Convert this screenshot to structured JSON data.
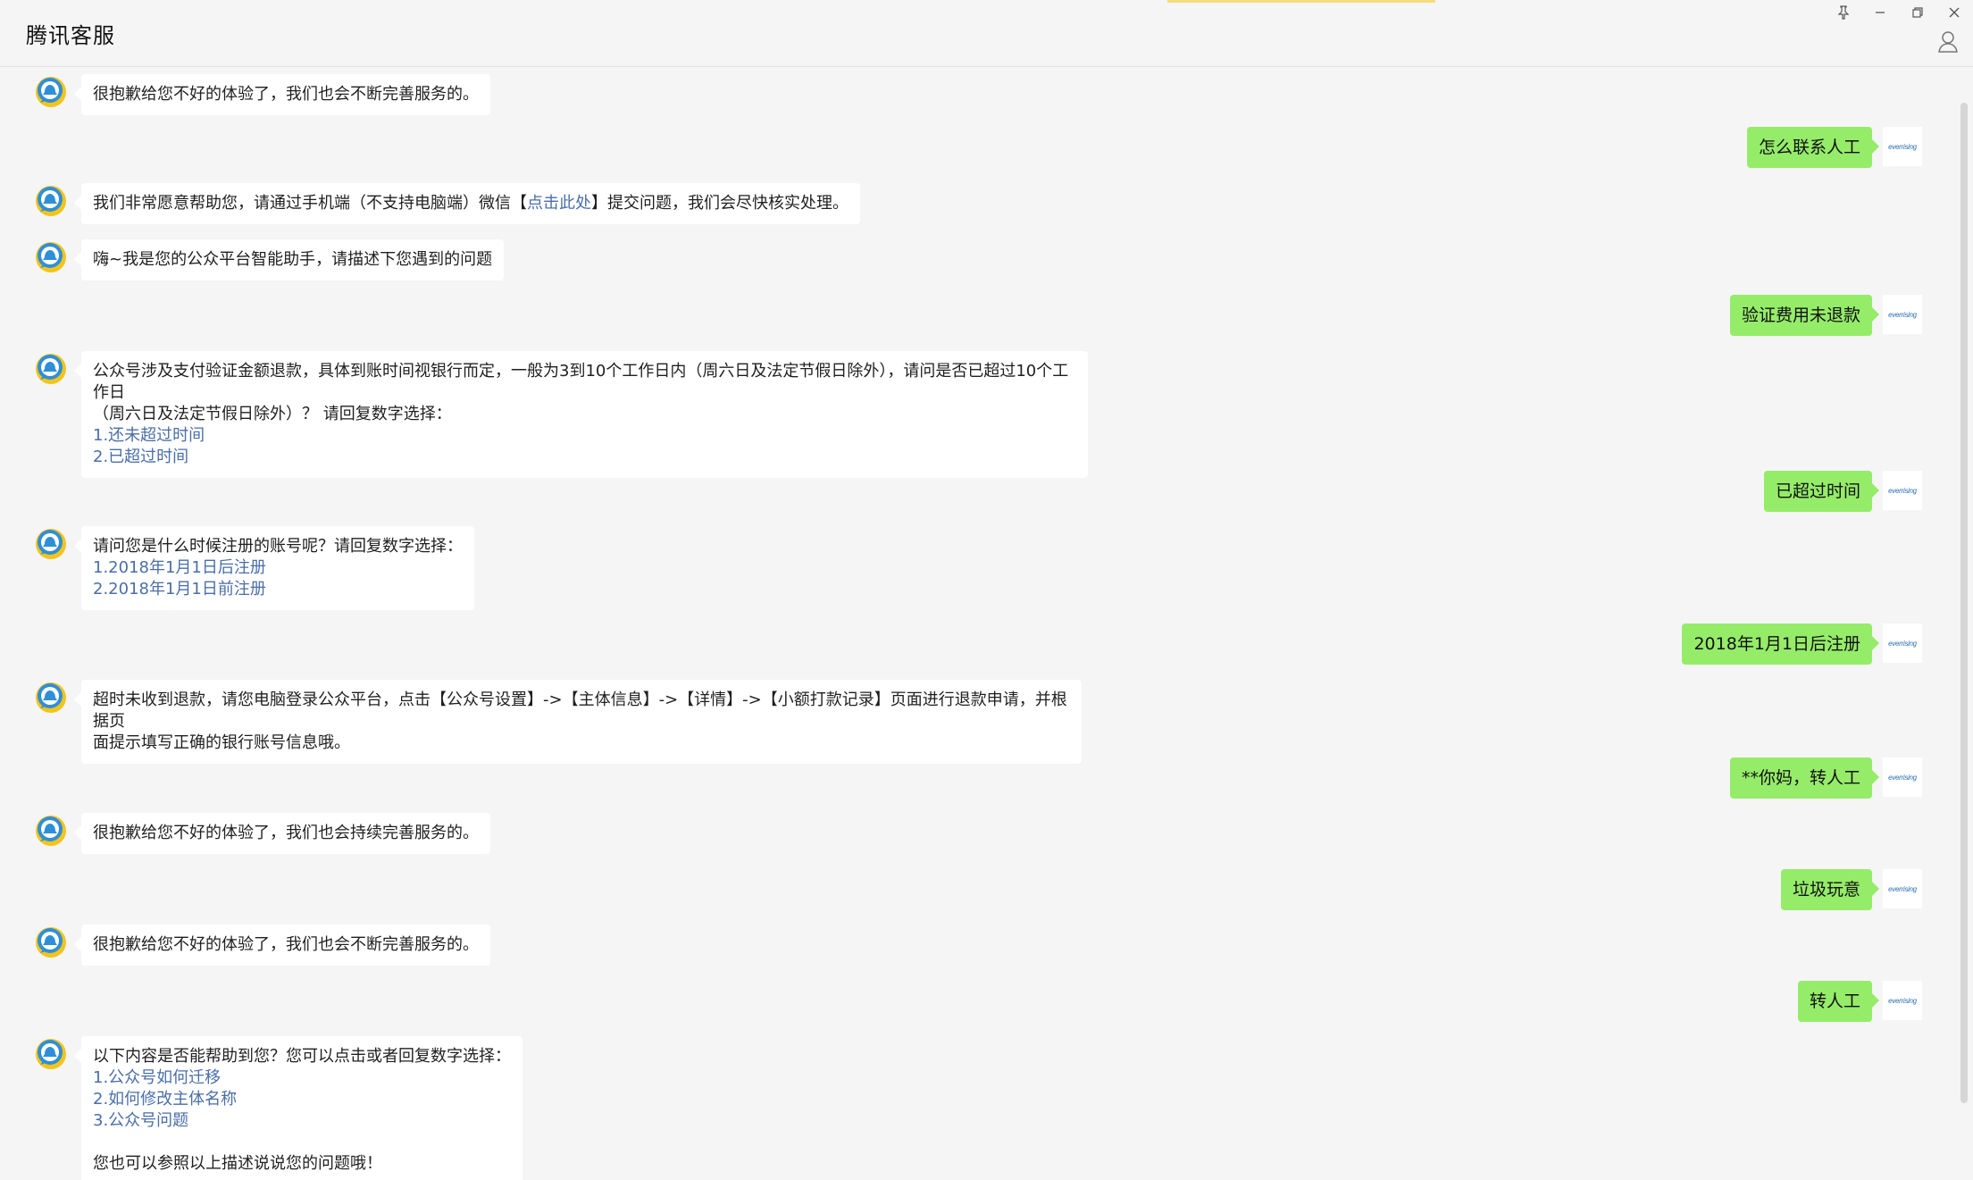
{
  "window": {
    "title": "腾讯客服",
    "controls": {
      "pin_icon": "pin-icon",
      "minimize_icon": "minimize-icon",
      "restore_icon": "restore-icon",
      "close_icon": "close-icon",
      "user_icon": "user-icon"
    }
  },
  "colors": {
    "background": "#f5f5f5",
    "bot_bubble": "#ffffff",
    "user_bubble": "#95ec69",
    "option_link": "#4a6ea9",
    "bot_avatar_blue": "#2f8fd6",
    "bot_avatar_yellow": "#f3c41b"
  },
  "user": {
    "avatar_text": "everrising"
  },
  "messages": [
    {
      "from": "bot",
      "text": "很抱歉给您不好的体验了，我们也会不断完善服务的。"
    },
    {
      "from": "user",
      "text": "怎么联系人工"
    },
    {
      "from": "bot",
      "before": "我们非常愿意帮助您，请通过手机端（不支持电脑端）微信【",
      "link": "点击此处",
      "after": "】提交问题，我们会尽快核实处理。"
    },
    {
      "from": "bot",
      "text": "嗨~我是您的公众平台智能助手，请描述下您遇到的问题"
    },
    {
      "from": "user",
      "text": "验证费用未退款"
    },
    {
      "from": "bot",
      "line1": "公众号涉及支付验证金额退款，具体到账时间视银行而定，一般为3到10个工作日内（周六日及法定节假日除外），请问是否已超过10个工作日",
      "line2": "（周六日及法定节假日除外）？ 请回复数字选择：",
      "options": [
        "1.还未超过时间",
        "2.已超过时间"
      ]
    },
    {
      "from": "user",
      "text": "已超过时间"
    },
    {
      "from": "bot",
      "text": "请问您是什么时候注册的账号呢？请回复数字选择：",
      "options": [
        "1.2018年1月1日后注册",
        "2.2018年1月1日前注册"
      ]
    },
    {
      "from": "user",
      "text": "2018年1月1日后注册"
    },
    {
      "from": "bot",
      "line1": "超时未收到退款，请您电脑登录公众平台，点击【公众号设置】->【主体信息】->【详情】->【小额打款记录】页面进行退款申请，并根据页",
      "line2": "面提示填写正确的银行账号信息哦。"
    },
    {
      "from": "user",
      "text": "**你妈，转人工"
    },
    {
      "from": "bot",
      "text": "很抱歉给您不好的体验了，我们也会持续完善服务的。"
    },
    {
      "from": "user",
      "text": "垃圾玩意"
    },
    {
      "from": "bot",
      "text": "很抱歉给您不好的体验了，我们也会不断完善服务的。"
    },
    {
      "from": "user",
      "text": "转人工"
    },
    {
      "from": "bot",
      "text": "以下内容是否能帮助到您？您可以点击或者回复数字选择：",
      "options": [
        "1.公众号如何迁移",
        "2.如何修改主体名称",
        "3.公众号问题"
      ],
      "footer": "您也可以参照以上描述说说您的问题哦！"
    }
  ]
}
